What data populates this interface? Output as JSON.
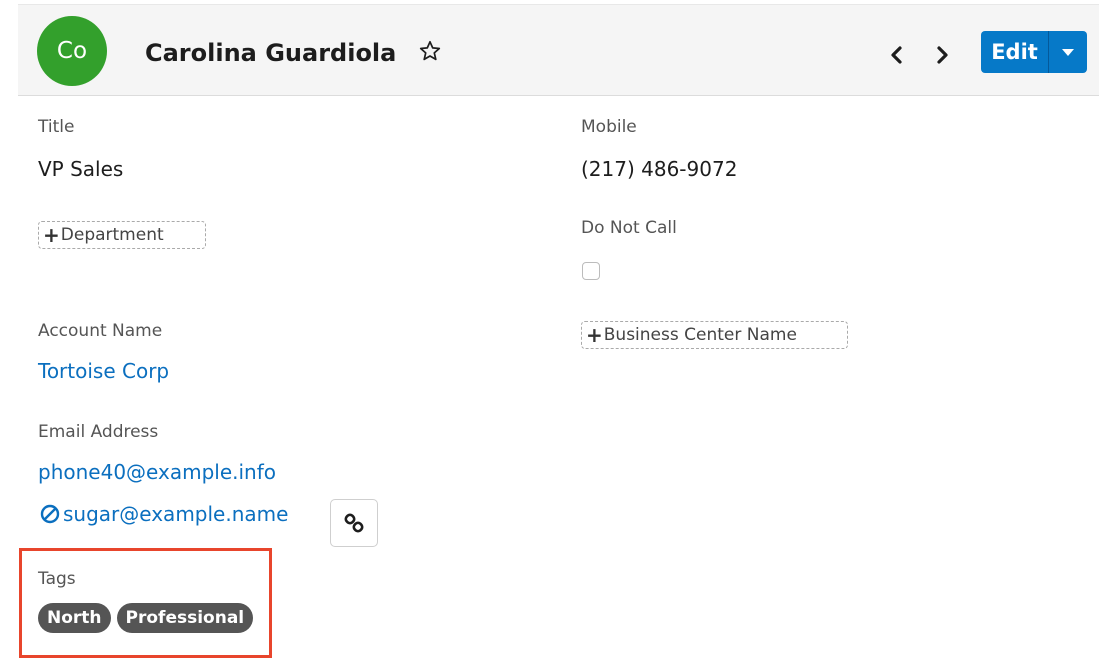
{
  "header": {
    "avatar_initials": "Co",
    "record_name": "Carolina Guardiola",
    "favorite_icon": "star-outline-icon",
    "prev_icon": "chevron-left-icon",
    "next_icon": "chevron-right-icon",
    "edit_label": "Edit",
    "edit_caret_icon": "caret-down-icon"
  },
  "fields": {
    "title": {
      "label": "Title",
      "value": "VP Sales"
    },
    "mobile": {
      "label": "Mobile",
      "value": "(217) 486-9072"
    },
    "department": {
      "add_label": "Department"
    },
    "do_not_call": {
      "label": "Do Not Call",
      "checked": false
    },
    "account_name": {
      "label": "Account Name",
      "value": "Tortoise Corp"
    },
    "business_center": {
      "add_label": "Business Center Name"
    },
    "email": {
      "label": "Email Address",
      "addresses": [
        "phone40@example.info",
        "sugar@example.name"
      ]
    },
    "tags": {
      "label": "Tags",
      "items": [
        "North",
        "Professional"
      ]
    }
  },
  "colors": {
    "avatar": "#33a02c",
    "primary_button": "#0679c8",
    "link": "#0b6fbf",
    "tag": "#555555",
    "highlight": "#e8452c"
  }
}
